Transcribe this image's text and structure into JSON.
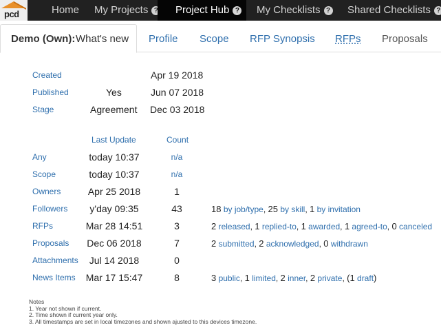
{
  "logo": {
    "text": "pcd"
  },
  "nav": [
    {
      "label": "Home",
      "help": false
    },
    {
      "label": "My Projects",
      "help": true
    },
    {
      "label": "Project Hub",
      "help": true,
      "active": true
    },
    {
      "label": "My Checklists",
      "help": true
    },
    {
      "label": "Shared Checklists",
      "help": true
    }
  ],
  "tabs": {
    "owner": "Demo (Own):",
    "active": "What's new",
    "profile": "Profile",
    "scope": "Scope",
    "rfp_synopsis": "RFP Synopsis",
    "rfps": "RFPs",
    "proposals": "Proposals"
  },
  "summary": [
    {
      "label": "Created",
      "flag": "",
      "date": "Apr 19 2018"
    },
    {
      "label": "Published",
      "flag": "Yes",
      "date": "Jun 07 2018"
    },
    {
      "label": "Stage",
      "flag": "Agreement",
      "date": "Dec 03 2018"
    }
  ],
  "table": {
    "headers": {
      "last_update": "Last Update",
      "count": "Count"
    },
    "rows": [
      {
        "label": "Any",
        "update": "today 10:37",
        "count": "n/a",
        "count_link": true,
        "details": []
      },
      {
        "label": "Scope",
        "update": "today 10:37",
        "count": "n/a",
        "count_link": true,
        "details": []
      },
      {
        "label": "Owners",
        "update": "Apr 25 2018",
        "count": "1",
        "count_link": false,
        "details": []
      },
      {
        "label": "Followers",
        "update": "y'day 09:35",
        "count": "43",
        "count_link": false,
        "details": [
          {
            "n": "18",
            "t": "by job/type"
          },
          {
            "n": "25",
            "t": "by skill"
          },
          {
            "n": "1",
            "t": "by invitation"
          }
        ]
      },
      {
        "label": "RFPs",
        "update": "Mar 28 14:51",
        "count": "3",
        "count_link": false,
        "details": [
          {
            "n": "2",
            "t": "released"
          },
          {
            "n": "1",
            "t": "replied-to"
          },
          {
            "n": "1",
            "t": "awarded"
          },
          {
            "n": "1",
            "t": "agreed-to"
          },
          {
            "n": "0",
            "t": "canceled"
          }
        ]
      },
      {
        "label": "Proposals",
        "update": "Dec 06 2018",
        "count": "7",
        "count_link": false,
        "details": [
          {
            "n": "2",
            "t": "submitted"
          },
          {
            "n": "2",
            "t": "acknowledged"
          },
          {
            "n": "0",
            "t": "withdrawn"
          }
        ]
      },
      {
        "label": "Attachments",
        "update": "Jul 14 2018",
        "count": "0",
        "count_link": false,
        "details": []
      },
      {
        "label": "News Items",
        "update": "Mar 17 15:47",
        "count": "8",
        "count_link": false,
        "details": [
          {
            "n": "3",
            "t": "public"
          },
          {
            "n": "1",
            "t": "limited"
          },
          {
            "n": "2",
            "t": "inner"
          },
          {
            "n": "2",
            "t": "private"
          },
          {
            "n": "(1",
            "t": "draft",
            "suffix": ")"
          }
        ]
      }
    ]
  },
  "notes": [
    "Notes",
    "1. Year not shown if current.",
    "2. Time shown if current year only.",
    "3. All timestamps are set in local timezones and shown ajusted to this devices timezone."
  ]
}
